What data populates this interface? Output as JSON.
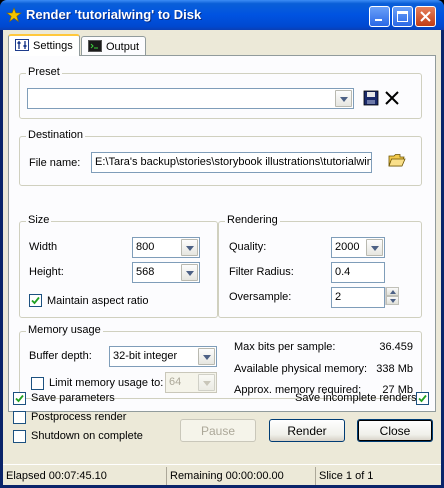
{
  "window": {
    "title": "Render 'tutorialwing' to Disk"
  },
  "tabs": [
    {
      "label": "Settings",
      "icon": "settings-sliders-icon",
      "active": true
    },
    {
      "label": "Output",
      "icon": "console-icon",
      "active": false
    }
  ],
  "preset": {
    "group_label": "Preset",
    "value": ""
  },
  "destination": {
    "group_label": "Destination",
    "file_name_label": "File name:",
    "file_name_value": "E:\\Tara's backup\\stories\\storybook illustrations\\tutorialwin"
  },
  "size": {
    "group_label": "Size",
    "width_label": "Width",
    "width_value": "800",
    "height_label": "Height:",
    "height_value": "568",
    "aspect_label": "Maintain aspect ratio",
    "aspect_checked": true
  },
  "rendering": {
    "group_label": "Rendering",
    "quality_label": "Quality:",
    "quality_value": "2000",
    "filter_label": "Filter Radius:",
    "filter_value": "0.4",
    "oversample_label": "Oversample:",
    "oversample_value": "2"
  },
  "memory": {
    "group_label": "Memory usage",
    "buffer_label": "Buffer depth:",
    "buffer_value": "32-bit integer",
    "limit_label": "Limit memory usage to:",
    "limit_checked": false,
    "limit_value": "64",
    "maxbits_label": "Max bits per sample:",
    "maxbits_value": "36.459",
    "avail_label": "Available physical memory:",
    "avail_value": "338 Mb",
    "approx_label": "Approx. memory required:",
    "approx_value": "27 Mb"
  },
  "options": {
    "save_params_label": "Save parameters",
    "save_params_checked": true,
    "postprocess_label": "Postprocess render",
    "postprocess_checked": false,
    "shutdown_label": "Shutdown on complete",
    "shutdown_checked": false,
    "save_incomplete_label": "Save incomplete renders",
    "save_incomplete_checked": true
  },
  "buttons": {
    "pause": "Pause",
    "render": "Render",
    "close": "Close"
  },
  "status": {
    "elapsed": "Elapsed 00:07:45.10",
    "remaining": "Remaining 00:00:00.00",
    "slice": "Slice 1 of 1"
  },
  "colors": {
    "titlebar": "#0053e1",
    "dialog_bg": "#ece9d8",
    "panel_bg": "#fcfcfe",
    "active_tab_accent": "#ffc83c"
  }
}
